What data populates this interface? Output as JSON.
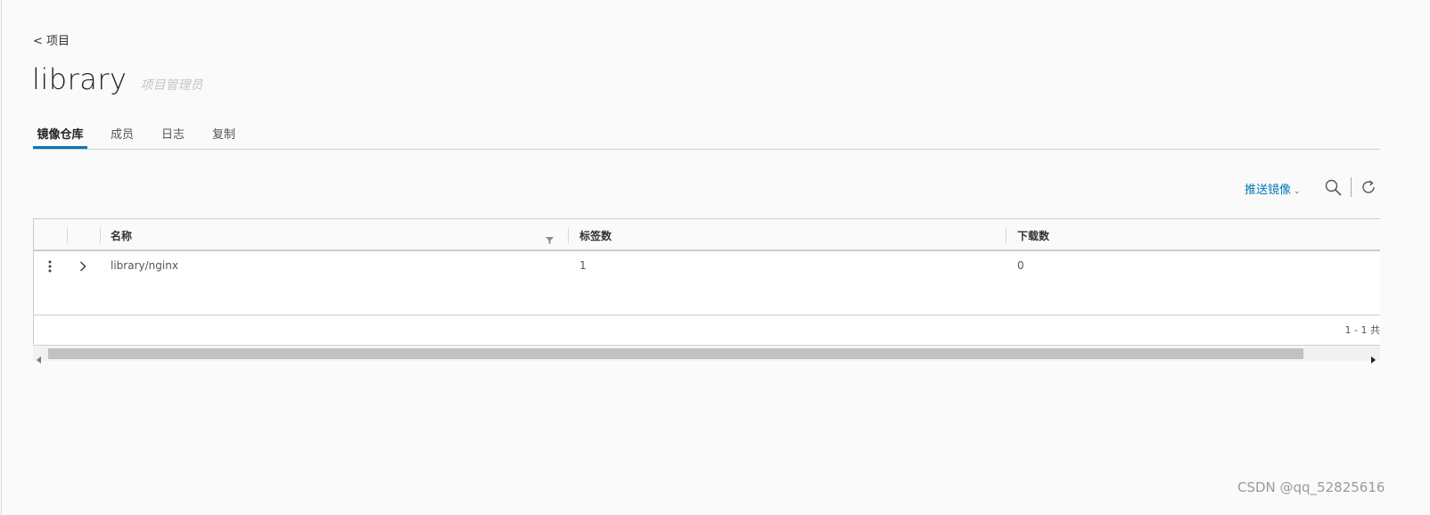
{
  "nav": {
    "back_label": "< 项目"
  },
  "project": {
    "name": "library",
    "role": "项目管理员"
  },
  "tabs": [
    {
      "label": "镜像仓库",
      "active": true
    },
    {
      "label": "成员",
      "active": false
    },
    {
      "label": "日志",
      "active": false
    },
    {
      "label": "复制",
      "active": false
    }
  ],
  "toolbar": {
    "push_image_label": "推送镜像",
    "icons": [
      "chevron-down-icon",
      "search-icon",
      "refresh-icon"
    ]
  },
  "table": {
    "columns": [
      "名称",
      "标签数",
      "下载数"
    ],
    "rows": [
      {
        "name": "library/nginx",
        "tags": "1",
        "pulls": "0"
      }
    ],
    "pagination": "1 - 1 共"
  },
  "colors": {
    "accent": "#0079b8",
    "border": "#cccccc",
    "background": "#fafafa"
  },
  "watermark": "CSDN @qq_52825616"
}
